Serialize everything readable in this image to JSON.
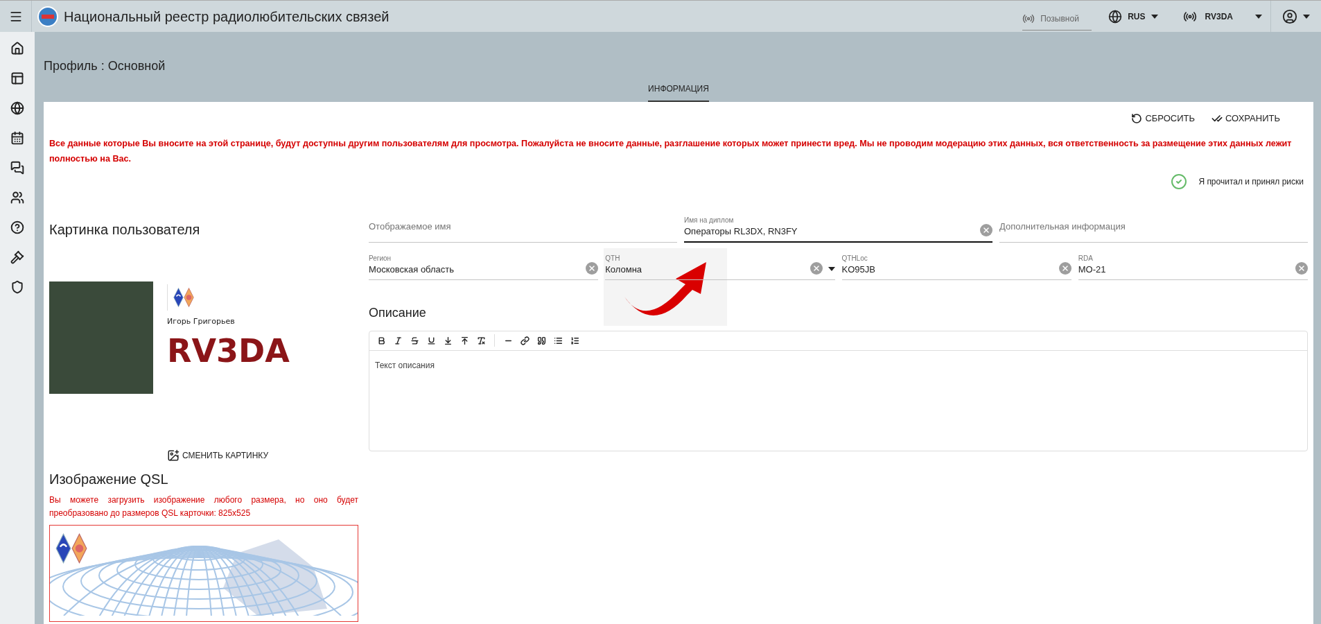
{
  "app_bar": {
    "title": "Национальный реестр радиолюбительских связей",
    "callsign_search": {
      "placeholder": "Позывной"
    },
    "language": "RUS",
    "station": "RV3DA"
  },
  "page": {
    "title": "Профиль : Основной",
    "tabs": [
      {
        "label": "ИНФОРМАЦИЯ",
        "selected": true
      }
    ]
  },
  "actions": [
    {
      "kind": "reset",
      "label": "СБРОСИТЬ"
    },
    {
      "kind": "save",
      "label": "СОХРАНИТЬ"
    }
  ],
  "warning": "Все данные которые Вы вносите на этой странице, будут доступны другим пользователям для просмотра. Пожалуйста не вносите данные, разглашение которых может принести вред. Мы не проводим модерацию этих данных, вся ответственность за размещение этих данных лежит полностью на Вас.",
  "risk_accept": {
    "label": "Я прочитал и принял риски",
    "checked": true
  },
  "user_picture": {
    "heading": "Картинка пользователя",
    "name": "Игорь Григорьев",
    "callsign": "RV3DA",
    "change_button": "СМЕНИТЬ КАРТИНКУ"
  },
  "qsl": {
    "heading": "Изображение QSL",
    "note": "Вы можете загрузить изображение любого размера, но оно будет преобразовано до размеров QSL карточки: 825x525"
  },
  "field_rows": [
    [
      {
        "kind": "text",
        "placeholder": "Отображаемое имя",
        "focused": false
      },
      {
        "kind": "text",
        "label": "Имя на диплом",
        "value": "Операторы RL3DX, RN3FY",
        "focused": true
      },
      {
        "kind": "text",
        "placeholder": "Дополнительная информация",
        "focused": false
      }
    ],
    [
      {
        "kind": "text",
        "label": "Регион",
        "value": "Московская область",
        "focused": false
      },
      {
        "kind": "select",
        "label": "QTH",
        "value": "Коломна",
        "focused": false
      },
      {
        "kind": "text",
        "label": "QTHLoc",
        "value": "KO95JB",
        "focused": false
      },
      {
        "kind": "text",
        "label": "RDA",
        "value": "MO-21",
        "focused": false
      }
    ]
  ],
  "description": {
    "heading": "Описание",
    "editor": {
      "placeholder": "Текст описания"
    }
  }
}
